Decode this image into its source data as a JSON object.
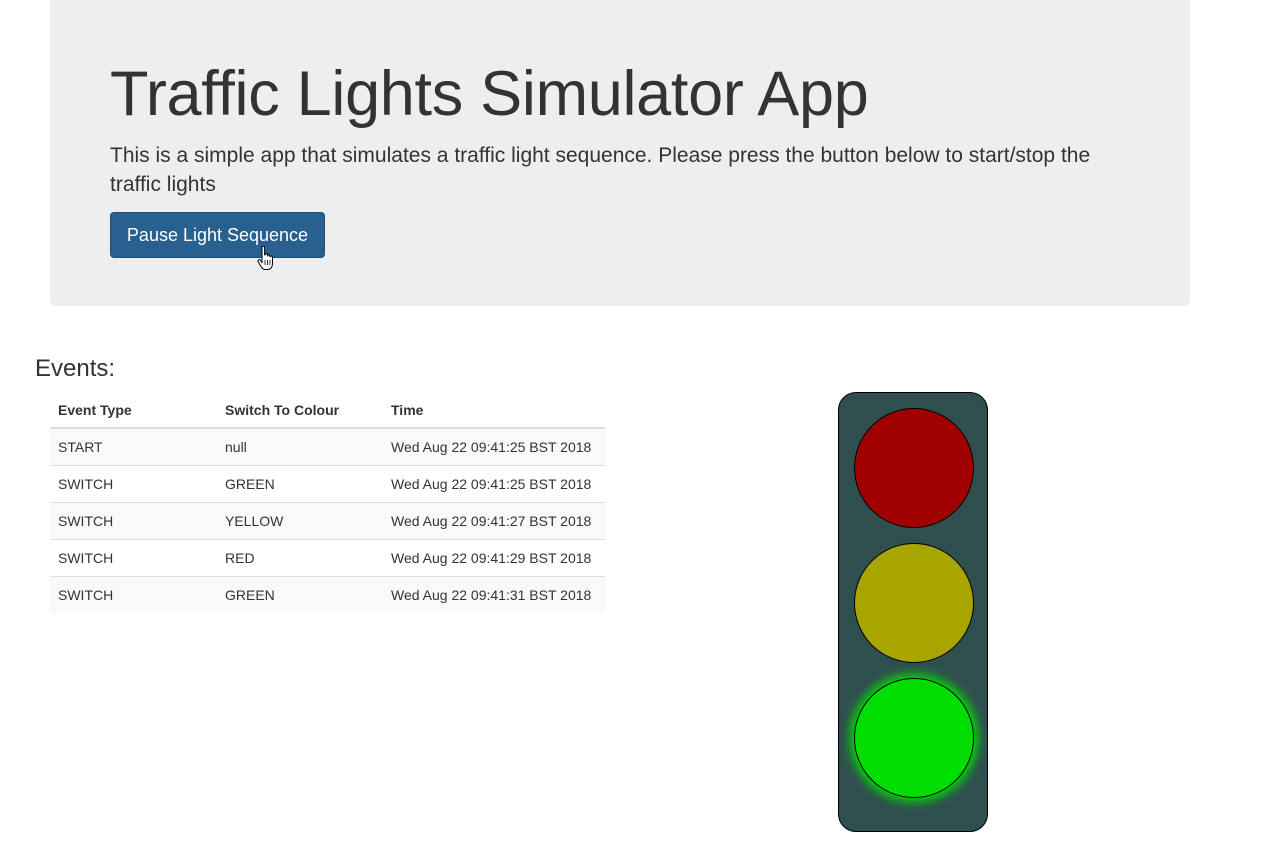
{
  "header": {
    "title": "Traffic Lights Simulator App",
    "description": "This is a simple app that simulates a traffic light sequence. Please press the button below to start/stop the traffic lights",
    "toggle_button_label": "Pause Light Sequence"
  },
  "events": {
    "heading": "Events:",
    "columns": [
      "Event Type",
      "Switch To Colour",
      "Time"
    ],
    "rows": [
      {
        "event_type": "START",
        "colour": "null",
        "time": "Wed Aug 22 09:41:25 BST 2018"
      },
      {
        "event_type": "SWITCH",
        "colour": "GREEN",
        "time": "Wed Aug 22 09:41:25 BST 2018"
      },
      {
        "event_type": "SWITCH",
        "colour": "YELLOW",
        "time": "Wed Aug 22 09:41:27 BST 2018"
      },
      {
        "event_type": "SWITCH",
        "colour": "RED",
        "time": "Wed Aug 22 09:41:29 BST 2018"
      },
      {
        "event_type": "SWITCH",
        "colour": "GREEN",
        "time": "Wed Aug 22 09:41:31 BST 2018"
      }
    ]
  },
  "traffic_light": {
    "housing_color": "#2f4f4f",
    "active_lamp": "green",
    "lamps": [
      {
        "name": "red",
        "color": "#a00000",
        "on": false
      },
      {
        "name": "yellow",
        "color": "#a8a400",
        "on": false
      },
      {
        "name": "green",
        "color": "#00dd00",
        "glow_color": "#00dd00",
        "on": true
      }
    ]
  },
  "colors": {
    "jumbotron_background": "#eeeeee",
    "button_background": "#286090",
    "button_border": "#204d74",
    "button_text": "#ffffff"
  },
  "cursor": {
    "icon": "hand-pointer-icon"
  }
}
